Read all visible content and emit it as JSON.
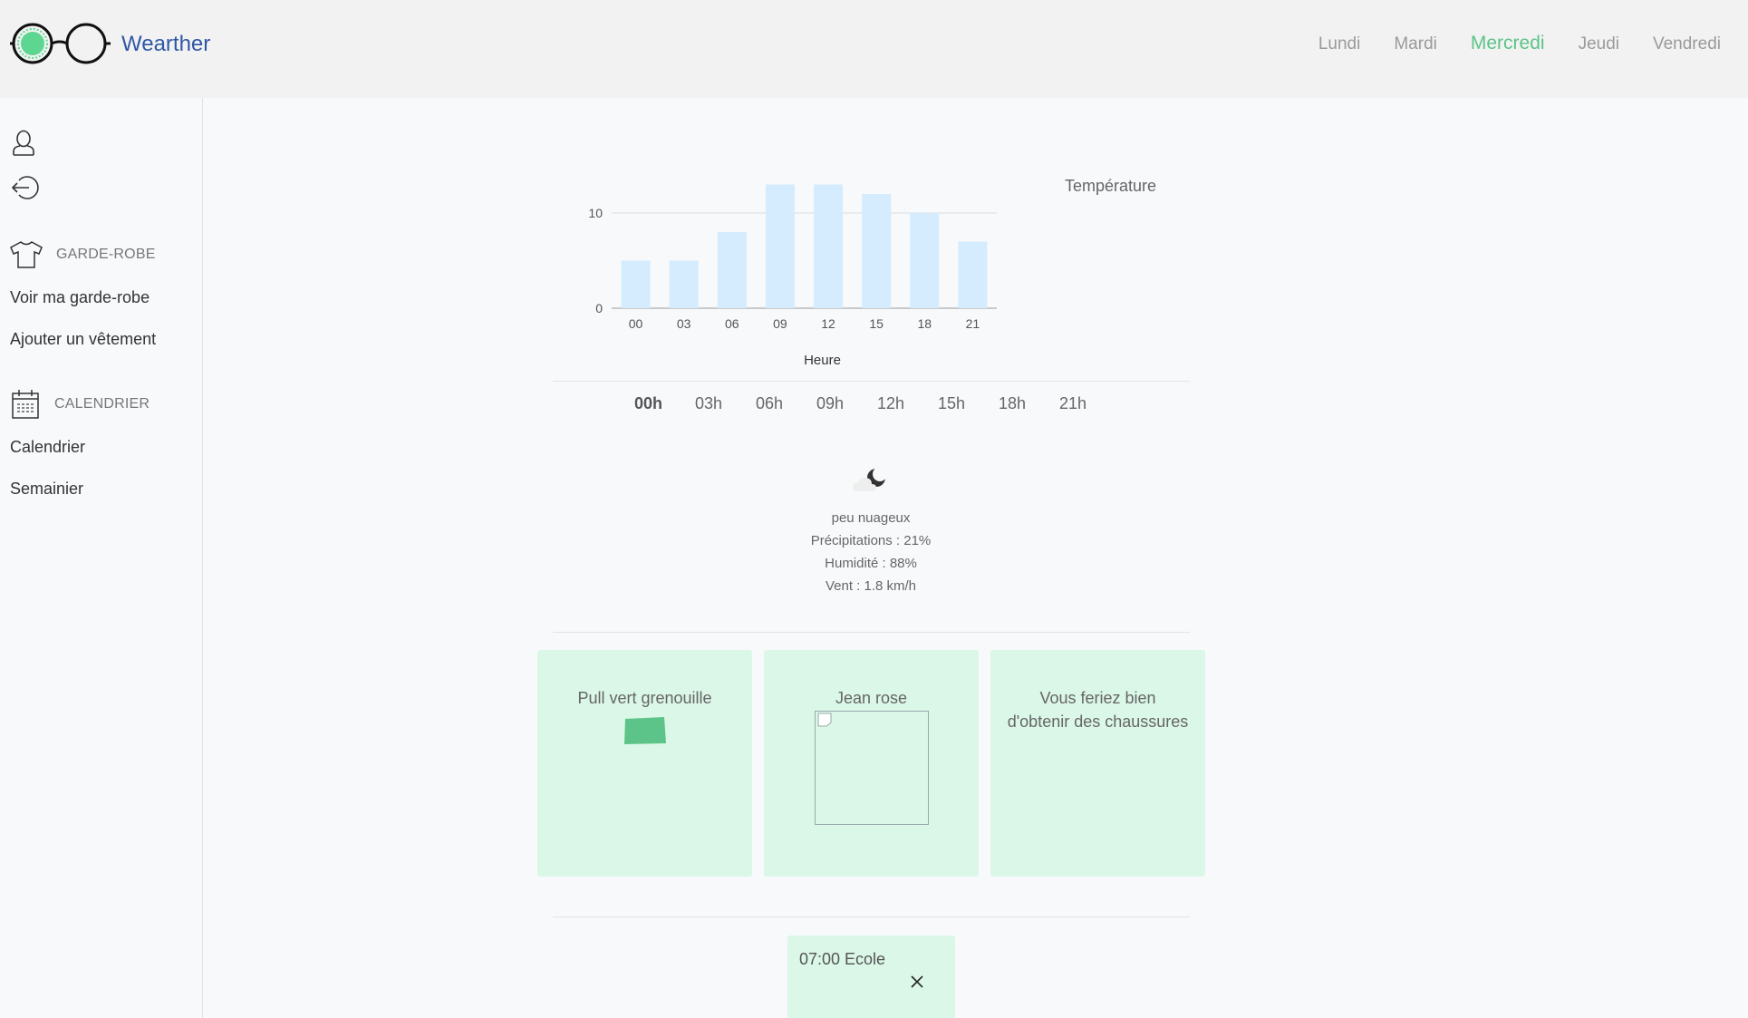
{
  "header": {
    "brand": "Wearther",
    "days": [
      "Lundi",
      "Mardi",
      "Mercredi",
      "Jeudi",
      "Vendredi"
    ],
    "active_day": "Mercredi"
  },
  "sidebar": {
    "profile_icon": "user-icon",
    "logout_icon": "logout-arrow-icon",
    "wardrobe_section": {
      "icon": "tshirt-icon",
      "label": "GARDE-ROBE"
    },
    "wardrobe_links": [
      "Voir ma garde-robe",
      "Ajouter un vêtement"
    ],
    "calendar_section": {
      "icon": "calendar-icon",
      "label": "CALENDRIER"
    },
    "calendar_links": [
      "Calendrier",
      "Semainier"
    ]
  },
  "chart_data": {
    "type": "bar",
    "categories": [
      "00",
      "03",
      "06",
      "09",
      "12",
      "15",
      "18",
      "21"
    ],
    "series": [
      {
        "name": "Température",
        "values": [
          5,
          5,
          8,
          13,
          13,
          12,
          10,
          7
        ]
      }
    ],
    "xlabel": "Heure",
    "ylabel": "",
    "yticks": [
      0,
      10
    ],
    "ylim": [
      0,
      14
    ],
    "legend": "top-right",
    "bar_color": "#d4ecfd",
    "grid": true
  },
  "hours": {
    "items": [
      "00h",
      "03h",
      "06h",
      "09h",
      "12h",
      "15h",
      "18h",
      "21h"
    ],
    "active": "00h"
  },
  "weather": {
    "icon": "partly-cloudy-night-icon",
    "description": "peu nuageux",
    "precipitation": "Précipitations : 21%",
    "humidity": "Humidité : 88%",
    "wind": "Vent : 1.8 km/h"
  },
  "outfit": {
    "cards": [
      {
        "title": "Pull vert grenouille",
        "image": "green-sweater-thumbnail",
        "swatch_color": "#5cc488"
      },
      {
        "title": "Jean rose",
        "image": "broken-image-placeholder"
      },
      {
        "title": "Vous feriez bien d'obtenir des chaussures"
      }
    ]
  },
  "event": {
    "text": "07:00 Ecole",
    "close_icon": "close-icon"
  }
}
